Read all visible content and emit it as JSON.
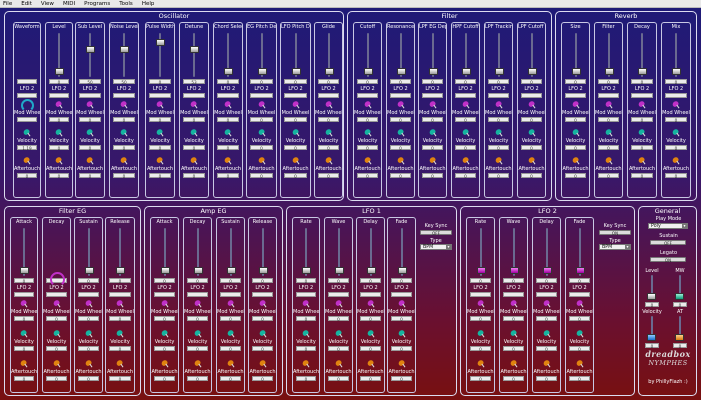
{
  "menu": [
    "File",
    "Edit",
    "View",
    "MIDI",
    "Programs",
    "Tools",
    "Help"
  ],
  "sections": [
    {
      "title": "Oscillator",
      "params": [
        {
          "name": "Waveform",
          "main": "",
          "mod": "",
          "vel": "1.19",
          "after": "0"
        },
        {
          "name": "Level",
          "main": "0",
          "mod": "0",
          "vel": "0",
          "after": "0"
        },
        {
          "name": "Sub Level",
          "main": "50",
          "mod": "0",
          "vel": "0",
          "after": "0"
        },
        {
          "name": "Noise Level",
          "main": "50",
          "mod": "0",
          "vel": "0",
          "after": "0"
        },
        {
          "name": "Pulse Width",
          "main": "0",
          "mod": "0",
          "vel": "0",
          "after": "0"
        },
        {
          "name": "Detune",
          "main": "53",
          "mod": "0",
          "vel": "0",
          "after": "0"
        },
        {
          "name": "Chord Select",
          "main": "0",
          "mod": "0",
          "vel": "0",
          "after": "0"
        },
        {
          "name": "EG Pitch Depth",
          "main": "0",
          "mod": "0",
          "vel": "0",
          "after": "0"
        },
        {
          "name": "LFO Pitch Depth",
          "main": "0",
          "mod": "0",
          "vel": "0",
          "after": "0"
        },
        {
          "name": "Glide",
          "main": "0",
          "mod": "0",
          "vel": "0",
          "after": "0"
        }
      ]
    },
    {
      "title": "Filter",
      "params": [
        {
          "name": "Cutoff",
          "main": "0",
          "mod": "0",
          "vel": "0",
          "after": "0"
        },
        {
          "name": "Resonance",
          "main": "0",
          "mod": "0",
          "vel": "0",
          "after": "0"
        },
        {
          "name": "LPF EG Depth",
          "main": "0",
          "mod": "0",
          "vel": "0",
          "after": "0"
        },
        {
          "name": "HPF Cutoff",
          "main": "0",
          "mod": "0",
          "vel": "0",
          "after": "0"
        },
        {
          "name": "LPF Tracking",
          "main": "0",
          "mod": "0",
          "vel": "0",
          "after": "0"
        },
        {
          "name": "LPF Cutoff Depth",
          "main": "0",
          "mod": "0",
          "vel": "0",
          "after": "0"
        }
      ]
    },
    {
      "title": "Reverb",
      "params": [
        {
          "name": "Size",
          "main": "0",
          "mod": "0",
          "vel": "0",
          "after": "0"
        },
        {
          "name": "Filter",
          "main": "0",
          "mod": "0",
          "vel": "0",
          "after": "0"
        },
        {
          "name": "Decay",
          "main": "0",
          "mod": "0",
          "vel": "0",
          "after": "0"
        },
        {
          "name": "Mix",
          "main": "0",
          "mod": "0",
          "vel": "0",
          "after": "0"
        }
      ]
    },
    {
      "title": "Filter EG",
      "params": [
        {
          "name": "Attack",
          "main": "0",
          "mod": "0",
          "vel": "0",
          "after": "0"
        },
        {
          "name": "Decay",
          "main": "",
          "mod": "0",
          "vel": "0",
          "after": "0"
        },
        {
          "name": "Sustain",
          "main": "0",
          "mod": "0",
          "vel": "0",
          "after": "0"
        },
        {
          "name": "Release",
          "main": "0",
          "mod": "0",
          "vel": "0",
          "after": "0"
        }
      ]
    },
    {
      "title": "Amp EG",
      "params": [
        {
          "name": "Attack",
          "main": "0",
          "mod": "0",
          "vel": "0",
          "after": "0"
        },
        {
          "name": "Decay",
          "main": "0",
          "mod": "0",
          "vel": "0",
          "after": "0"
        },
        {
          "name": "Sustain",
          "main": "0",
          "mod": "0",
          "vel": "0",
          "after": "0"
        },
        {
          "name": "Release",
          "main": "0",
          "mod": "0",
          "vel": "0",
          "after": "0"
        }
      ]
    },
    {
      "title": "LFO 1",
      "params": [
        {
          "name": "Rate",
          "main": "0",
          "mod": "0",
          "vel": "0",
          "after": "0"
        },
        {
          "name": "Wave",
          "main": "0",
          "mod": "0",
          "vel": "0",
          "after": "0"
        },
        {
          "name": "Delay",
          "main": "0",
          "mod": "0",
          "vel": "0",
          "after": "0"
        },
        {
          "name": "Fade",
          "main": "0",
          "mod": "0",
          "vel": "0",
          "after": "0"
        }
      ]
    },
    {
      "title": "LFO 2",
      "params": [
        {
          "name": "Rate",
          "main": "0",
          "mod": "0",
          "vel": "0",
          "after": "0"
        },
        {
          "name": "Wave",
          "main": "0",
          "mod": "0",
          "vel": "0",
          "after": "0"
        },
        {
          "name": "Delay",
          "main": "0",
          "mod": "0",
          "vel": "0",
          "after": "0"
        },
        {
          "name": "Fade",
          "main": "0",
          "mod": "0",
          "vel": "0",
          "after": "0"
        }
      ]
    },
    {
      "title": "General",
      "params": []
    }
  ],
  "row_labels": {
    "lfo": "LFO 2",
    "mod": "Mod Wheel",
    "vel": "Velocity",
    "after": "Aftertouch"
  },
  "lfo1": {
    "key_sync_label": "Key Sync",
    "key_sync_value": "OFF",
    "type_label": "Type",
    "type_value": "BPM"
  },
  "lfo2": {
    "key_sync_label": "Key Sync",
    "key_sync_value": "ON",
    "type_label": "Type",
    "type_value": "BPM"
  },
  "general": {
    "play_mode_label": "Play Mode",
    "play_mode_value": "Poly",
    "sustain_label": "Sustain",
    "sustain_value": "OFF",
    "legato_label": "Legato",
    "legato_value": "ON",
    "level_label": "Level",
    "mw_label": "MW",
    "velocity_label": "Velocity",
    "at_label": "AT",
    "level_value": "0",
    "mw_value": "0",
    "velocity_value": "0",
    "at_value": "0"
  },
  "brand": {
    "line1": "dreadbox",
    "line2": "NYMPHES",
    "credit": "by PhillyFlazh :)"
  },
  "colors": {
    "mod": "#c030c8",
    "vel": "#15b4a0",
    "after": "#e0830f",
    "arc": "#20a8c8"
  }
}
